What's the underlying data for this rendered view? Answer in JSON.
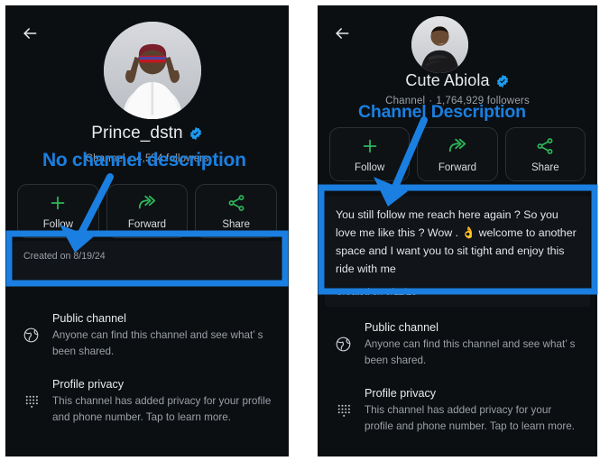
{
  "annotations": {
    "color": "#1a7fe0",
    "left_label": "No channel description",
    "right_label": "Channel Description"
  },
  "panels": [
    {
      "id": "left",
      "back_icon": "back-arrow-icon",
      "avatar_alt": "profile-photo",
      "channel_name": "Prince_dstn",
      "verified_icon": "verified-badge-icon",
      "type_label": "Channel",
      "separator": "·",
      "followers": "4,554 followers",
      "actions": [
        {
          "label": "Follow",
          "icon": "plus-icon"
        },
        {
          "label": "Forward",
          "icon": "forward-arrow-icon"
        },
        {
          "label": "Share",
          "icon": "share-icon"
        }
      ],
      "description": "",
      "created_on": "Created on 8/19/24",
      "info_rows": [
        {
          "icon": "globe-icon",
          "title": "Public channel",
          "desc": "Anyone can find this channel and see what’ s been shared."
        },
        {
          "icon": "privacy-dots-icon",
          "title": "Profile privacy",
          "desc": "This channel has added privacy for your profile and phone number. Tap to learn more."
        }
      ]
    },
    {
      "id": "right",
      "back_icon": "back-arrow-icon",
      "avatar_alt": "profile-photo",
      "channel_name": "Cute Abiola",
      "verified_icon": "verified-badge-icon",
      "type_label": "Channel",
      "separator": "·",
      "followers": "1,764,929 followers",
      "actions": [
        {
          "label": "Follow",
          "icon": "plus-icon"
        },
        {
          "label": "Forward",
          "icon": "forward-arrow-icon"
        },
        {
          "label": "Share",
          "icon": "share-icon"
        }
      ],
      "description_part1": "You still follow me reach here again ? So you love me like this ? Wow . ",
      "description_emoji": "👌",
      "description_part2": " welcome to another space and I want you to sit tight and enjoy this ride with me",
      "created_on": "Created on 9/11/23",
      "info_rows": [
        {
          "icon": "globe-icon",
          "title": "Public channel",
          "desc": "Anyone can find this channel and see what’ s been shared."
        },
        {
          "icon": "privacy-dots-icon",
          "title": "Profile privacy",
          "desc": "This channel has added privacy for your profile and phone number. Tap to learn more."
        }
      ]
    }
  ],
  "theme": {
    "panel_bg": "#0c0f12",
    "card_bg": "#111418",
    "accent_green": "#2eb85c",
    "verified_blue": "#1d9bf0",
    "text_primary": "#e8eaed",
    "text_secondary": "#9aa0a6"
  }
}
